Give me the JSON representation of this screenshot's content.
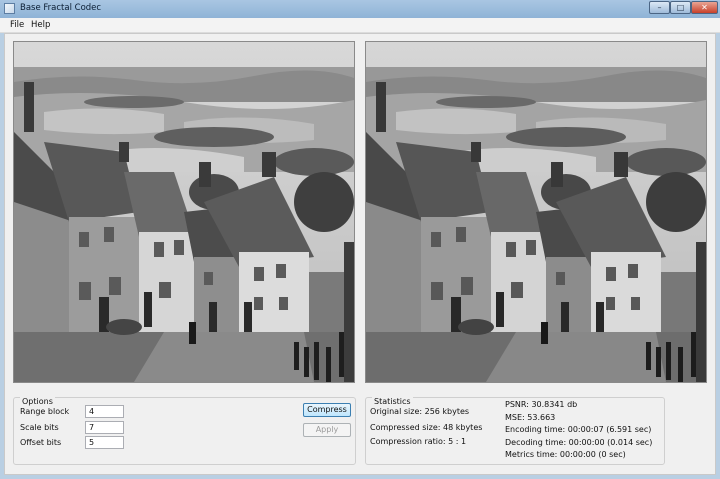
{
  "window": {
    "title": "Base Fractal Codec",
    "minimize": "–",
    "maximize": "□",
    "close": "✕"
  },
  "menu": [
    "File",
    "Help"
  ],
  "options": {
    "title": "Options",
    "range_label": "Range block",
    "range_value": "4",
    "scale_label": "Scale bits",
    "scale_value": "7",
    "offset_label": "Offset bits",
    "offset_value": "5",
    "compress": "Compress",
    "apply": "Apply"
  },
  "statistics": {
    "title": "Statistics",
    "original_size": "Original size: 256 kbytes",
    "compressed_size": "Compressed size: 48 kbytes",
    "ratio": "Compression ratio: 5 : 1",
    "psnr": "PSNR: 30.8341 db",
    "mse": "MSE: 53.663",
    "encoding": "Encoding time: 00:00:07 (6.591 sec)",
    "decoding": "Decoding time: 00:00:00 (0.014 sec)",
    "metrics": "Metrics time: 00:00:00 (0 sec)"
  }
}
